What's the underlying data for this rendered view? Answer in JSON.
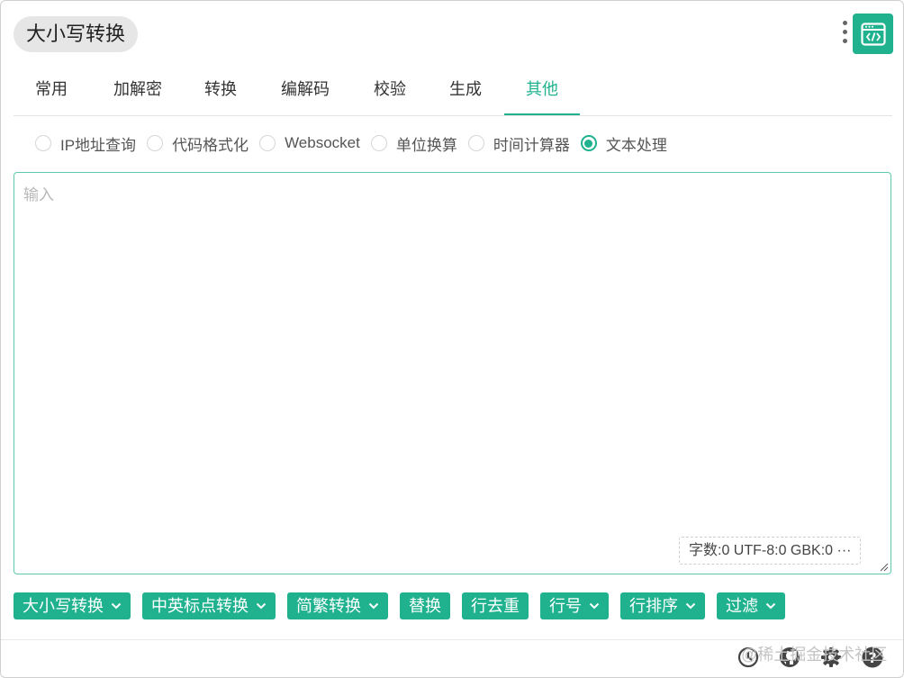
{
  "header": {
    "title": "大小写转换",
    "menu_icon": "kebab-menu-icon",
    "app_icon": "code-window-icon"
  },
  "tabs": [
    {
      "label": "常用"
    },
    {
      "label": "加解密"
    },
    {
      "label": "转换"
    },
    {
      "label": "编解码"
    },
    {
      "label": "校验"
    },
    {
      "label": "生成"
    },
    {
      "label": "其他",
      "active": true
    }
  ],
  "radios": [
    {
      "label": "IP地址查询",
      "checked": false
    },
    {
      "label": "代码格式化",
      "checked": false
    },
    {
      "label": "Websocket",
      "checked": false
    },
    {
      "label": "单位换算",
      "checked": false
    },
    {
      "label": "时间计算器",
      "checked": false
    },
    {
      "label": "文本处理",
      "checked": true
    }
  ],
  "editor": {
    "placeholder": "输入",
    "value": "",
    "stats": "字数:0 UTF-8:0 GBK:0 ···"
  },
  "actions": [
    {
      "label": "大小写转换",
      "dropdown": true
    },
    {
      "label": "中英标点转换",
      "dropdown": true
    },
    {
      "label": "简繁转换",
      "dropdown": true
    },
    {
      "label": "替换",
      "dropdown": false
    },
    {
      "label": "行去重",
      "dropdown": false
    },
    {
      "label": "行号",
      "dropdown": true
    },
    {
      "label": "行排序",
      "dropdown": true
    },
    {
      "label": "过滤",
      "dropdown": true
    }
  ],
  "footer": {
    "watermark": "@稀土掘金技术社区",
    "icons": [
      "history-icon",
      "github-icon",
      "settings-icon",
      "help-icon"
    ]
  },
  "colors": {
    "accent": "#20b28f",
    "border": "#5fc8ad"
  }
}
